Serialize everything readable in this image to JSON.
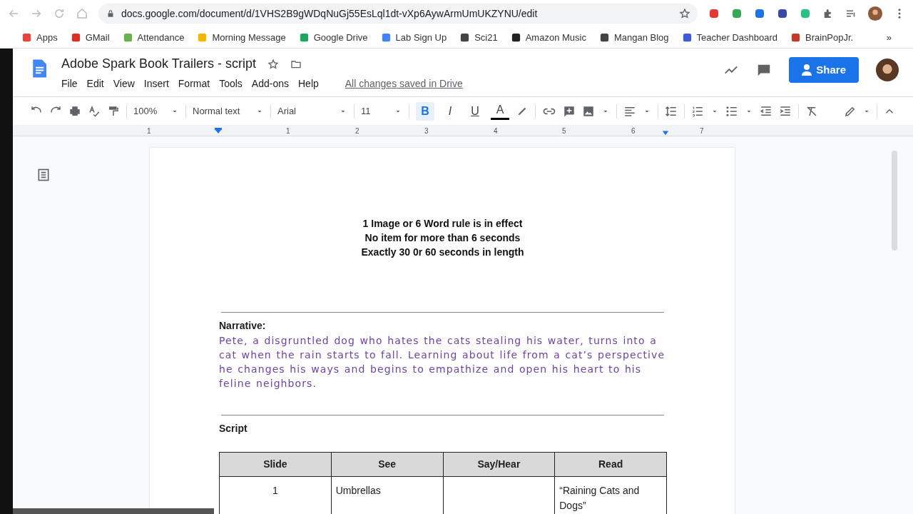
{
  "browser": {
    "url": "docs.google.com/document/d/1VHS2B9gWDqNuGj55EsLql1dt-vXp6AywArmUmUKZYNU/edit",
    "bookmarks": [
      {
        "label": "Apps",
        "color": "#e8453c"
      },
      {
        "label": "GMail",
        "color": "#d93025"
      },
      {
        "label": "Attendance",
        "color": "#6ab04c"
      },
      {
        "label": "Morning Message",
        "color": "#f4b400"
      },
      {
        "label": "Google Drive",
        "color": "#1fa463"
      },
      {
        "label": "Lab Sign Up",
        "color": "#4285f4"
      },
      {
        "label": "Sci21",
        "color": "#444444"
      },
      {
        "label": "Amazon Music",
        "color": "#222222"
      },
      {
        "label": "Mangan Blog",
        "color": "#444444"
      },
      {
        "label": "Teacher Dashboard",
        "color": "#3b5bdb"
      },
      {
        "label": "BrainPopJr.",
        "color": "#c0392b"
      }
    ],
    "more": "»"
  },
  "doc": {
    "title": "Adobe Spark Book Trailers - script",
    "menus": [
      "File",
      "Edit",
      "View",
      "Insert",
      "Format",
      "Tools",
      "Add-ons",
      "Help"
    ],
    "save_status": "All changes saved in Drive",
    "share": "Share"
  },
  "toolbar": {
    "zoom": "100%",
    "style": "Normal text",
    "font": "Arial",
    "size": "11",
    "formats": [
      {
        "label": "B",
        "selected": true
      },
      {
        "label": "I",
        "selected": false
      },
      {
        "label": "U",
        "selected": false
      }
    ],
    "text_color_label": "A"
  },
  "ruler": [
    "1",
    "1",
    "2",
    "3",
    "4",
    "5",
    "6",
    "7"
  ],
  "page": {
    "rules": [
      "1 Image or 6 Word rule is in effect",
      "No item for more than 6 seconds",
      "Exactly 30 0r 60 seconds in length"
    ],
    "narrative_label": "Narrative:",
    "narrative": "Pete, a disgruntled dog who hates the cats stealing his water, turns into a cat when the rain starts to fall. Learning about life from a cat’s perspective he changes his ways and begins to empathize and open his heart to his feline neighbors.",
    "script_heading": "Script",
    "table": {
      "columns": [
        "Slide",
        "See",
        "Say/Hear",
        "Read"
      ],
      "rows": [
        {
          "slide": "1",
          "see": "Umbrellas",
          "read": "“Raining Cats and Dogs”"
        }
      ]
    }
  }
}
